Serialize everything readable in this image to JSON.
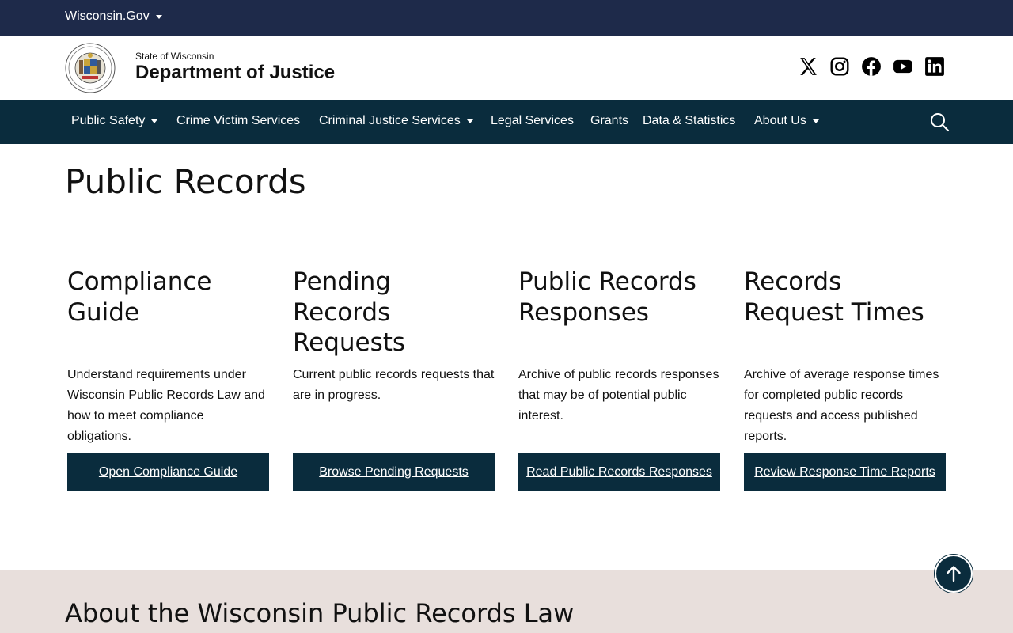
{
  "gov_bar": {
    "label": "Wisconsin.Gov"
  },
  "header": {
    "state_label": "State of Wisconsin",
    "department": "Department of Justice",
    "social": [
      "x-icon",
      "instagram-icon",
      "facebook-icon",
      "youtube-icon",
      "linkedin-icon"
    ]
  },
  "nav": {
    "items": [
      {
        "label": "Public Safety",
        "dropdown": true
      },
      {
        "label": "Crime Victim Services",
        "dropdown": false
      },
      {
        "label": "Criminal Justice Services",
        "dropdown": true
      },
      {
        "label": "Legal Services",
        "dropdown": false
      },
      {
        "label": "Grants",
        "dropdown": false
      },
      {
        "label": "Data & Statistics",
        "dropdown": false
      },
      {
        "label": "About Us",
        "dropdown": true
      }
    ],
    "search_icon": "search-icon"
  },
  "page": {
    "title": "Public Records"
  },
  "cards": [
    {
      "title": "Compliance Guide",
      "description": "Understand requirements under Wisconsin Public Records Law and how to meet compliance obligations.",
      "button": "Open Compliance Guide"
    },
    {
      "title": "Pending Records Requests",
      "description": "Current public records requests that are in progress.",
      "button": "Browse Pending Requests"
    },
    {
      "title": "Public Records Responses",
      "description": "Archive of public records responses that may be of potential public interest.",
      "button": "Read Public Records Responses"
    },
    {
      "title": "Records Request Times",
      "description": "Archive of average response times for completed public records requests and access published reports.",
      "button": "Review Response Time Reports"
    }
  ],
  "about": {
    "title": "About the Wisconsin Public Records Law"
  },
  "colors": {
    "gov_bar": "#1e2a4a",
    "nav": "#0a2c3d",
    "about_bg": "#e8dfdc"
  }
}
